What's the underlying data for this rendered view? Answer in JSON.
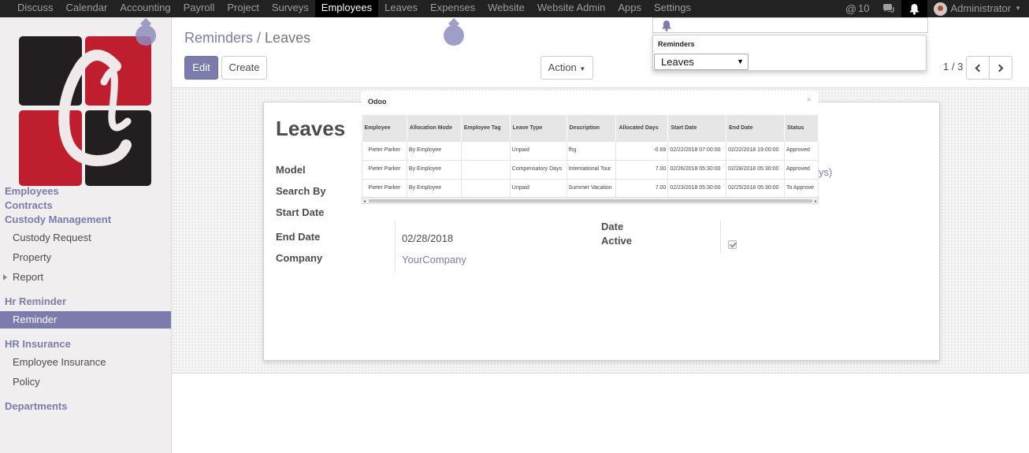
{
  "topnav": {
    "items": [
      "Discuss",
      "Calendar",
      "Accounting",
      "Payroll",
      "Project",
      "Surveys",
      "Employees",
      "Leaves",
      "Expenses",
      "Website",
      "Website Admin",
      "Apps",
      "Settings"
    ],
    "active": "Employees",
    "mentions_count": "10",
    "user_name": "Administrator"
  },
  "sidebar": {
    "categories": {
      "employees": "Employees",
      "contracts": "Contracts",
      "custody": "Custody Management",
      "hr_reminder": "Hr Reminder",
      "hr_insurance": "HR Insurance",
      "departments": "Departments"
    },
    "items": {
      "custody_request": "Custody Request",
      "property": "Property",
      "report": "Report",
      "reminder": "Reminder",
      "employee_insurance": "Employee Insurance",
      "policy": "Policy"
    }
  },
  "control_panel": {
    "breadcrumb_parent": "Reminders /",
    "breadcrumb_current": "Leaves",
    "edit_label": "Edit",
    "create_label": "Create",
    "action_label": "Action",
    "pager": "1 / 3"
  },
  "form": {
    "title": "Leaves",
    "labels": {
      "model": "Model",
      "search_by": "Search By",
      "start_date": "Start Date",
      "end_date": "End Date",
      "company": "Company",
      "date": "Date",
      "active": "Active"
    },
    "end_date_value": "02/28/2018",
    "company_value": "YourCompany",
    "hidden_fragment": "ys)"
  },
  "popup": {
    "title": "Odoo",
    "close": "×",
    "columns": [
      "Employee",
      "Allocation Mode",
      "Employee Tag",
      "Leave Type",
      "Description",
      "Allocated Days",
      "Start Date",
      "End Date",
      "Status"
    ],
    "rows": [
      [
        "Pieter Parker",
        "By Employee",
        "",
        "Unpaid",
        "fhg",
        "-0.69",
        "02/22/2018 07:00:00",
        "02/22/2018 19:00:00",
        "Approved"
      ],
      [
        "Pieter Parker",
        "By Employee",
        "",
        "Compensatory Days",
        "International Tour",
        "7.00",
        "02/26/2018 05:30:00",
        "02/28/2018 05:30:00",
        "Approved"
      ],
      [
        "Pieter Parker",
        "By Employee",
        "",
        "Unpaid",
        "Summer Vacation",
        "7.00",
        "02/23/2018 05:30:00",
        "02/25/2018 05:30:00",
        "To Approve"
      ]
    ]
  },
  "reminder_panel": {
    "title": "Reminders",
    "selected": "Leaves"
  },
  "colors": {
    "accent": "#7c7bad",
    "navbar": "#222222"
  }
}
